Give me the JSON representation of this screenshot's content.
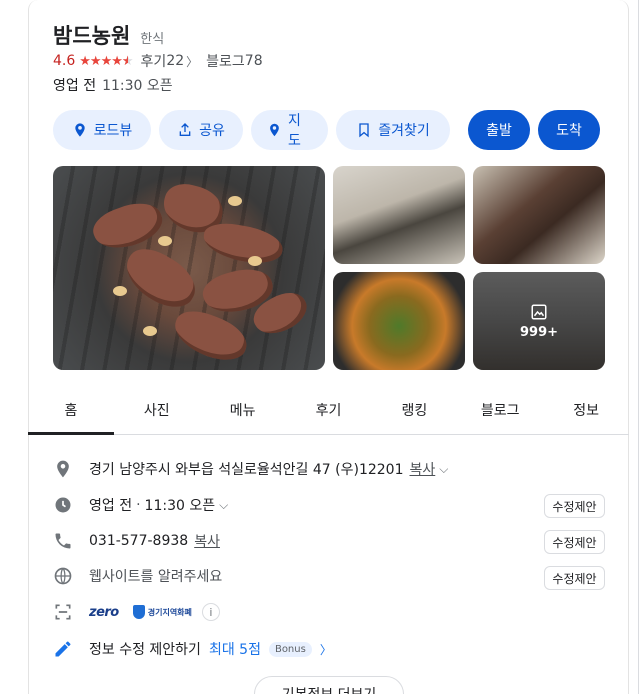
{
  "place": {
    "name": "밤드농원",
    "category": "한식",
    "rating": "4.6",
    "stars_value": 4.6,
    "review_label": "후기",
    "review_count": "22",
    "blog_label": "블로그",
    "blog_count": "78",
    "hours_status": "영업 전",
    "hours_detail": "11:30 오픈"
  },
  "actions": {
    "roadview": "로드뷰",
    "share": "공유",
    "map": "지도",
    "save": "즐겨찾기",
    "depart": "출발",
    "arrive": "도착"
  },
  "photos": {
    "more_count": "999+"
  },
  "tabs": [
    "홈",
    "사진",
    "메뉴",
    "후기",
    "랭킹",
    "블로그",
    "정보"
  ],
  "info": {
    "address": "경기 남양주시 와부읍 석실로율석안길 47 (우)12201",
    "copy": "복사",
    "hours_status": "영업 전",
    "hours_detail": "11:30 오픈",
    "phone": "031-577-8938",
    "website_prompt": "웹사이트를 알려주세요",
    "suggest_edit": "수정제안",
    "zero_pay": "zero",
    "gg_currency": "경기지역화폐",
    "info_i": "i",
    "edit_prompt": "정보 수정 제안하기",
    "max_points": "최대 5점",
    "bonus": "Bonus"
  },
  "more_basic": "기본정보 더보기",
  "colors": {
    "accent_blue": "#0b57d0",
    "pill_bg": "#e8f0fe",
    "rating_red": "#c5221f"
  }
}
